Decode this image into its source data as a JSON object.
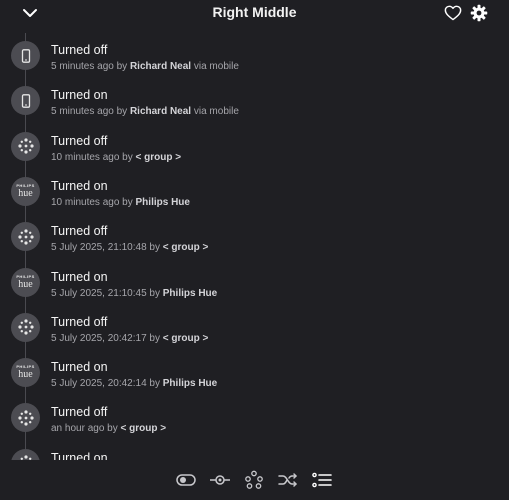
{
  "header": {
    "title": "Right Middle",
    "collapse_icon": "chevron-down-icon",
    "favorite_icon": "heart-outline-icon",
    "settings_icon": "gear-icon"
  },
  "events": [
    {
      "event": "Turned off",
      "time": "5 minutes ago",
      "by_label": "by",
      "actor": "Richard Neal",
      "via": "via mobile",
      "source_icon": "phone-icon"
    },
    {
      "event": "Turned on",
      "time": "5 minutes ago",
      "by_label": "by",
      "actor": "Richard Neal",
      "via": "via mobile",
      "source_icon": "phone-icon"
    },
    {
      "event": "Turned off",
      "time": "10 minutes ago",
      "by_label": "by",
      "actor": "< group >",
      "via": "",
      "source_icon": "group-icon"
    },
    {
      "event": "Turned on",
      "time": "10 minutes ago",
      "by_label": "by",
      "actor": "Philips Hue",
      "via": "",
      "source_icon": "philips-hue-logo",
      "hue_brand": "PHILIPS",
      "hue_word": "hue"
    },
    {
      "event": "Turned off",
      "time": "5 July 2025, 21:10:48",
      "by_label": "by",
      "actor": "< group >",
      "via": "",
      "source_icon": "group-icon"
    },
    {
      "event": "Turned on",
      "time": "5 July 2025, 21:10:45",
      "by_label": "by",
      "actor": "Philips Hue",
      "via": "",
      "source_icon": "philips-hue-logo",
      "hue_brand": "PHILIPS",
      "hue_word": "hue"
    },
    {
      "event": "Turned off",
      "time": "5 July 2025, 20:42:17",
      "by_label": "by",
      "actor": "< group >",
      "via": "",
      "source_icon": "group-icon"
    },
    {
      "event": "Turned on",
      "time": "5 July 2025, 20:42:14",
      "by_label": "by",
      "actor": "Philips Hue",
      "via": "",
      "source_icon": "philips-hue-logo",
      "hue_brand": "PHILIPS",
      "hue_word": "hue"
    },
    {
      "event": "Turned off",
      "time": "an hour ago",
      "by_label": "by",
      "actor": "< group >",
      "via": "",
      "source_icon": "group-icon"
    },
    {
      "event": "Turned on",
      "time": "",
      "by_label": "",
      "actor": "",
      "via": "",
      "source_icon": "group-icon"
    }
  ],
  "bottom_nav": {
    "items": [
      {
        "name": "toggle-icon",
        "active": false
      },
      {
        "name": "device-icon",
        "active": false
      },
      {
        "name": "group-icon",
        "active": false
      },
      {
        "name": "shuffle-icon",
        "active": false
      },
      {
        "name": "history-list-icon",
        "active": true
      }
    ]
  },
  "colors": {
    "background": "#1f1f23",
    "avatar_bg": "#4c4c52",
    "timeline_line": "#4a4a50",
    "secondary_text": "#a6a6ab"
  }
}
